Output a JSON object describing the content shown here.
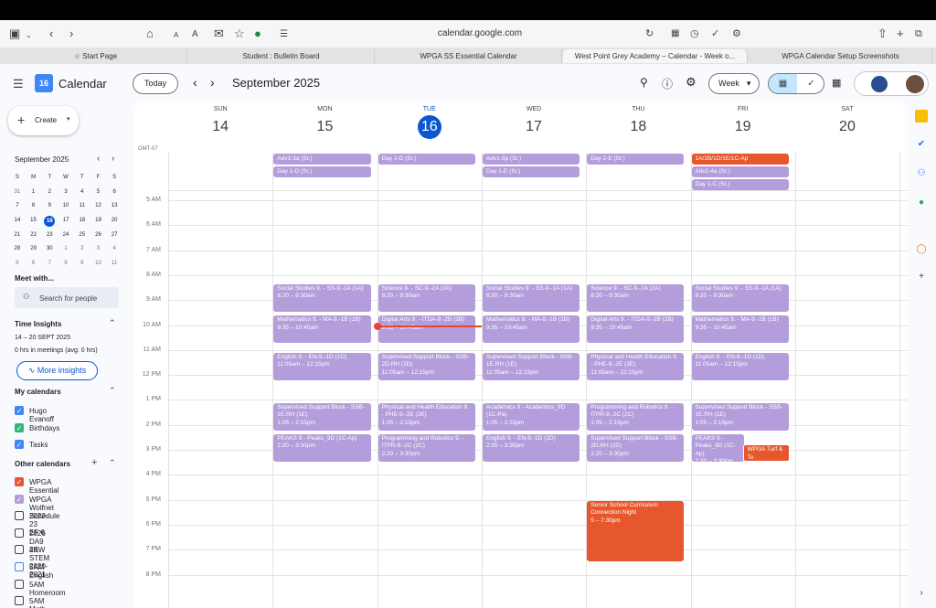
{
  "browser": {
    "url": "calendar.google.com",
    "tabs": [
      "Start Page",
      "Student : Bulletin Board",
      "WPGA SS Essential Calendar",
      "West Point Grey Academy – Calendar - Week o...",
      "WPGA Calendar Setup Screenshots"
    ]
  },
  "header": {
    "app_name": "Calendar",
    "today_button": "Today",
    "month_title": "September 2025",
    "view_selector": "Week"
  },
  "sidebar": {
    "create_label": "Create",
    "mini_cal": {
      "title": "September 2025",
      "weekdays": [
        "S",
        "M",
        "T",
        "W",
        "T",
        "F",
        "S"
      ],
      "weeks": [
        [
          "31",
          "1",
          "2",
          "3",
          "4",
          "5",
          "6"
        ],
        [
          "7",
          "8",
          "9",
          "10",
          "11",
          "12",
          "13"
        ],
        [
          "14",
          "15",
          "16",
          "17",
          "18",
          "19",
          "20"
        ],
        [
          "21",
          "22",
          "23",
          "24",
          "25",
          "26",
          "27"
        ],
        [
          "28",
          "29",
          "30",
          "1",
          "2",
          "3",
          "4"
        ],
        [
          "5",
          "6",
          "7",
          "8",
          "9",
          "10",
          "11"
        ]
      ]
    },
    "meet_with": "Meet with...",
    "search_people": "Search for people",
    "time_insights": "Time Insights",
    "insights_range": "14 – 20 SEPT 2025",
    "insights_hours": "0 hrs in meetings (avg: 0 hrs)",
    "more_insights": "More insights",
    "my_calendars_title": "My calendars",
    "my_calendars": [
      {
        "label": "Hugo Evanoff",
        "color": "#4285f4",
        "checked": true
      },
      {
        "label": "Birthdays",
        "color": "#33b679",
        "checked": true
      },
      {
        "label": "Tasks",
        "color": "#4285f4",
        "checked": true
      }
    ],
    "other_calendars_title": "Other calendars",
    "other_calendars": [
      {
        "label": "WPGA Essential",
        "color": "#e6572e",
        "checked": true
      },
      {
        "label": "WPGA Wolfnet Schedule",
        "color": "#b39ddb",
        "checked": true
      },
      {
        "label": "2022-23 EF 6",
        "color": "#444444",
        "checked": false
      },
      {
        "label": "2026 DA9 2B",
        "color": "#444444",
        "checked": false
      },
      {
        "label": "4KW STEM 2020-2021",
        "color": "#444444",
        "checked": false
      },
      {
        "label": "5AM English",
        "color": "#4285f4",
        "checked": false
      },
      {
        "label": "5AM Homeroom",
        "color": "#444444",
        "checked": false
      },
      {
        "label": "5AM Math",
        "color": "#444444",
        "checked": false
      }
    ]
  },
  "grid": {
    "timezone": "GMT-07",
    "days": [
      {
        "name": "SUN",
        "num": "14"
      },
      {
        "name": "MON",
        "num": "15"
      },
      {
        "name": "TUE",
        "num": "16",
        "today": true
      },
      {
        "name": "WED",
        "num": "17"
      },
      {
        "name": "THU",
        "num": "18"
      },
      {
        "name": "FRI",
        "num": "19"
      },
      {
        "name": "SAT",
        "num": "20"
      }
    ],
    "hours": [
      "5 AM",
      "6 AM",
      "7 AM",
      "8 AM",
      "9 AM",
      "10 AM",
      "11 AM",
      "12 PM",
      "1 PM",
      "2 PM",
      "3 PM",
      "4 PM",
      "5 PM",
      "6 PM",
      "7 PM",
      "8 PM"
    ],
    "allday": [
      {
        "day": 1,
        "row": 0,
        "title": "Adv1-3a (Sr.)"
      },
      {
        "day": 1,
        "row": 1,
        "title": "Day 1-D (Sr.)"
      },
      {
        "day": 2,
        "row": 0,
        "title": "Day 2-D (Sr.)"
      },
      {
        "day": 3,
        "row": 0,
        "title": "Adv1-5p (Sr.)"
      },
      {
        "day": 3,
        "row": 1,
        "title": "Day 1-E (Sr.)"
      },
      {
        "day": 4,
        "row": 0,
        "title": "Day 2-E (Sr.)"
      },
      {
        "day": 5,
        "row": 0,
        "title": "1A/1B/1D/1E/1C-Ap",
        "color": "orange"
      },
      {
        "day": 5,
        "row": 1,
        "title": "Adv1-4a (Sr.)"
      },
      {
        "day": 5,
        "row": 2,
        "title": "Day 1-C (Sr.)"
      }
    ],
    "events": [
      {
        "day": 1,
        "start": 8.33,
        "end": 9.5,
        "title": "Social Studies 9. - SS-9.-1A (1A)",
        "time": "8:20 – 9:30am"
      },
      {
        "day": 1,
        "start": 9.58,
        "end": 10.75,
        "title": "Mathematics 9. - MA-9.-1B (1B)",
        "time": "9:35 – 10:45am"
      },
      {
        "day": 1,
        "start": 11.08,
        "end": 12.25,
        "title": "English 9. - EN-9.-1D (1D)",
        "time": "11:05am – 12:15pm"
      },
      {
        "day": 1,
        "start": 13.08,
        "end": 14.25,
        "title": "Supervised Support Block - SSB-1E.RH (1E)",
        "time": "1:05 – 2:15pm"
      },
      {
        "day": 1,
        "start": 14.33,
        "end": 15.5,
        "title": "PEAKS 9 - Peaks_9D (1C-Ap)",
        "time": "2:20 – 3:30pm"
      },
      {
        "day": 2,
        "start": 8.33,
        "end": 9.5,
        "title": "Science 9. - SC-9.-2A (2A)",
        "time": "8:20 – 9:30am"
      },
      {
        "day": 2,
        "start": 9.58,
        "end": 10.75,
        "title": "Digital Arts 9. - ITDA-9.-2B (2B)",
        "time": "9:35 – 10:45am"
      },
      {
        "day": 2,
        "start": 11.08,
        "end": 12.25,
        "title": "Supervised Support Block - SSB-2D.RH (2D)",
        "time": "11:05am – 12:15pm"
      },
      {
        "day": 2,
        "start": 13.08,
        "end": 14.25,
        "title": "Physical and Health Education 9. - PHE-9.-2E (2E)",
        "time": "1:05 – 2:15pm"
      },
      {
        "day": 2,
        "start": 14.33,
        "end": 15.5,
        "title": "Programming and Robotics 9. - ITPR-9.-2C (2C)",
        "time": "2:20 – 3:30pm"
      },
      {
        "day": 3,
        "start": 8.33,
        "end": 9.5,
        "title": "Social Studies 9. - SS-9.-1A (1A)",
        "time": "8:20 – 9:30am"
      },
      {
        "day": 3,
        "start": 9.58,
        "end": 10.75,
        "title": "Mathematics 9. - MA-9.-1B (1B)",
        "time": "9:35 – 10:45am"
      },
      {
        "day": 3,
        "start": 11.08,
        "end": 12.25,
        "title": "Supervised Support Block - SSB-1E.RH (1E)",
        "time": "11:05am – 12:15pm"
      },
      {
        "day": 3,
        "start": 13.08,
        "end": 14.25,
        "title": "Academics 9 - Academics_9D (1C-Pa)",
        "time": "1:05 – 2:15pm"
      },
      {
        "day": 3,
        "start": 14.33,
        "end": 15.5,
        "title": "English 9. - EN-9.-1D (1D)",
        "time": "2:20 – 3:30pm"
      },
      {
        "day": 4,
        "start": 8.33,
        "end": 9.5,
        "title": "Science 9. - SC-9.-2A (2A)",
        "time": "8:20 – 9:30am"
      },
      {
        "day": 4,
        "start": 9.58,
        "end": 10.75,
        "title": "Digital Arts 9. - ITDA-9.-2B (2B)",
        "time": "9:35 – 10:45am"
      },
      {
        "day": 4,
        "start": 11.08,
        "end": 12.25,
        "title": "Physical and Health Education 9. - PHE-9.-2E (2E)",
        "time": "11:05am – 12:15pm"
      },
      {
        "day": 4,
        "start": 13.08,
        "end": 14.25,
        "title": "Programming and Robotics 9. - ITPR-9.-2C (2C)",
        "time": "1:05 – 2:15pm"
      },
      {
        "day": 4,
        "start": 14.33,
        "end": 15.5,
        "title": "Supervised Support Block - SSB-2D.RH (2D)",
        "time": "2:20 – 3:30pm"
      },
      {
        "day": 4,
        "start": 17,
        "end": 19.5,
        "title": "Senior School Curriculum Connection Night",
        "time": "5 – 7:30pm",
        "color": "orange"
      },
      {
        "day": 5,
        "start": 8.33,
        "end": 9.5,
        "title": "Social Studies 9. - SS-9.-1A (1A)",
        "time": "8:20 – 9:30am"
      },
      {
        "day": 5,
        "start": 9.58,
        "end": 10.75,
        "title": "Mathematics 9. - MA-9.-1B (1B)",
        "time": "9:35 – 10:45am"
      },
      {
        "day": 5,
        "start": 11.08,
        "end": 12.25,
        "title": "English 9. - EN-9.-1D (1D)",
        "time": "11:05am – 12:15pm"
      },
      {
        "day": 5,
        "start": 13.08,
        "end": 14.25,
        "title": "Supervised Support Block - SSB-1E.RH (1E)",
        "time": "1:05 – 2:15pm"
      },
      {
        "day": 5,
        "start": 14.33,
        "end": 15.5,
        "title": "PEAKS 9 - Peaks_9D (1C-Ap)",
        "time": "2:20 – 3:30pm",
        "narrow": true
      },
      {
        "day": 5,
        "start": 14.75,
        "end": 15.5,
        "title": "WPGA Turf & Te",
        "time": "2:45pm, Turf & T",
        "color": "orange",
        "overlay": true
      }
    ],
    "now_hour": 10.0
  }
}
